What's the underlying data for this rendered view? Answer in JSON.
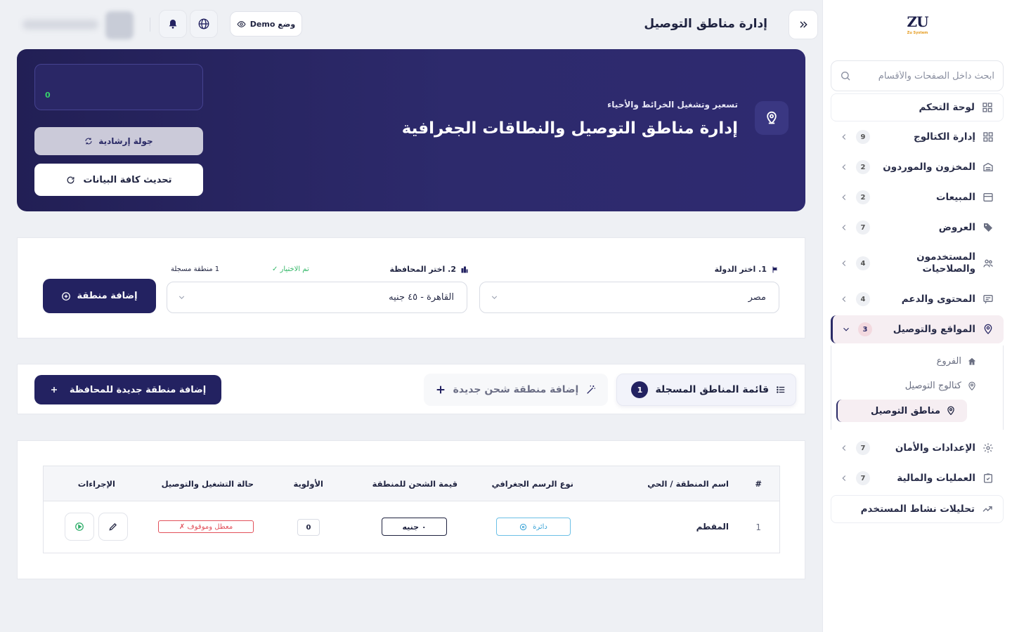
{
  "logo": {
    "mark": "ZU",
    "sub": "Zu System"
  },
  "sidebar": {
    "search_placeholder": "ابحث داخل الصفحات والأقسام",
    "dashboard": "لوحة التحكم",
    "items": [
      {
        "label": "إدارة الكتالوج",
        "count": "9"
      },
      {
        "label": "المخزون والموردون",
        "count": "2"
      },
      {
        "label": "المبيعات",
        "count": "2"
      },
      {
        "label": "العروض",
        "count": "7"
      },
      {
        "label": "المستخدمون والصلاحيات",
        "count": "4"
      },
      {
        "label": "المحتوى والدعم",
        "count": "4"
      },
      {
        "label": "المواقع والتوصيل",
        "count": "3"
      },
      {
        "label": "الإعدادات والأمان",
        "count": "7"
      },
      {
        "label": "العمليات والمالية",
        "count": "7"
      }
    ],
    "sub_items": [
      {
        "label": "الفروع"
      },
      {
        "label": "كتالوج التوصيل"
      },
      {
        "label": "مناطق التوصيل"
      }
    ],
    "analytics": "تحليلات نشاط المستخدم"
  },
  "topbar": {
    "title": "إدارة مناطق التوصيل",
    "demo_label": "وضع Demo"
  },
  "hero": {
    "subtitle": "تسعير وتشغيل الخرائط والأحياء",
    "title": "إدارة مناطق التوصيل والنطاقات الجغرافية",
    "panel_value": "0",
    "tour_label": "جولة إرشادية",
    "refresh_label": "تحديث كافة البيانات"
  },
  "filters": {
    "country_label": "1. اختر الدولة",
    "selected_hint": "تم الاختيار ✓",
    "country_value": "مصر",
    "governorate_label": "2. اختر المحافظة",
    "registered_hint": "1 منطقة مسجلة",
    "governorate_value": "القاهرة - ٤٥ جنيه",
    "add_zone_label": "إضافة منطقة"
  },
  "tabs": {
    "list_label": "قائمة المناطق المسجلة",
    "list_count": "1",
    "add_shipping_label": "إضافة منطقة شحن جديدة",
    "add_gov_label": "إضافة منطقة جديدة للمحافظة"
  },
  "table": {
    "headers": {
      "index": "#",
      "name": "اسم المنطقة / الحي",
      "geo_type": "نوع الرسم الجغرافي",
      "shipping": "قيمة الشحن للمنطقة",
      "priority": "الأولوية",
      "status": "حالة التشغيل والتوصيل",
      "actions": "الإجراءات"
    },
    "rows": [
      {
        "index": "1",
        "name": "المقطم",
        "geo_type": "دائرة",
        "shipping": "٠ جنيه",
        "priority": "0",
        "status": "معطل وموقوف ✗"
      }
    ]
  },
  "colors": {
    "primary": "#232261",
    "hero_bg": "#2d2a6c",
    "success": "#36d06c",
    "danger": "#e2505a",
    "info": "#3aa3d6"
  }
}
